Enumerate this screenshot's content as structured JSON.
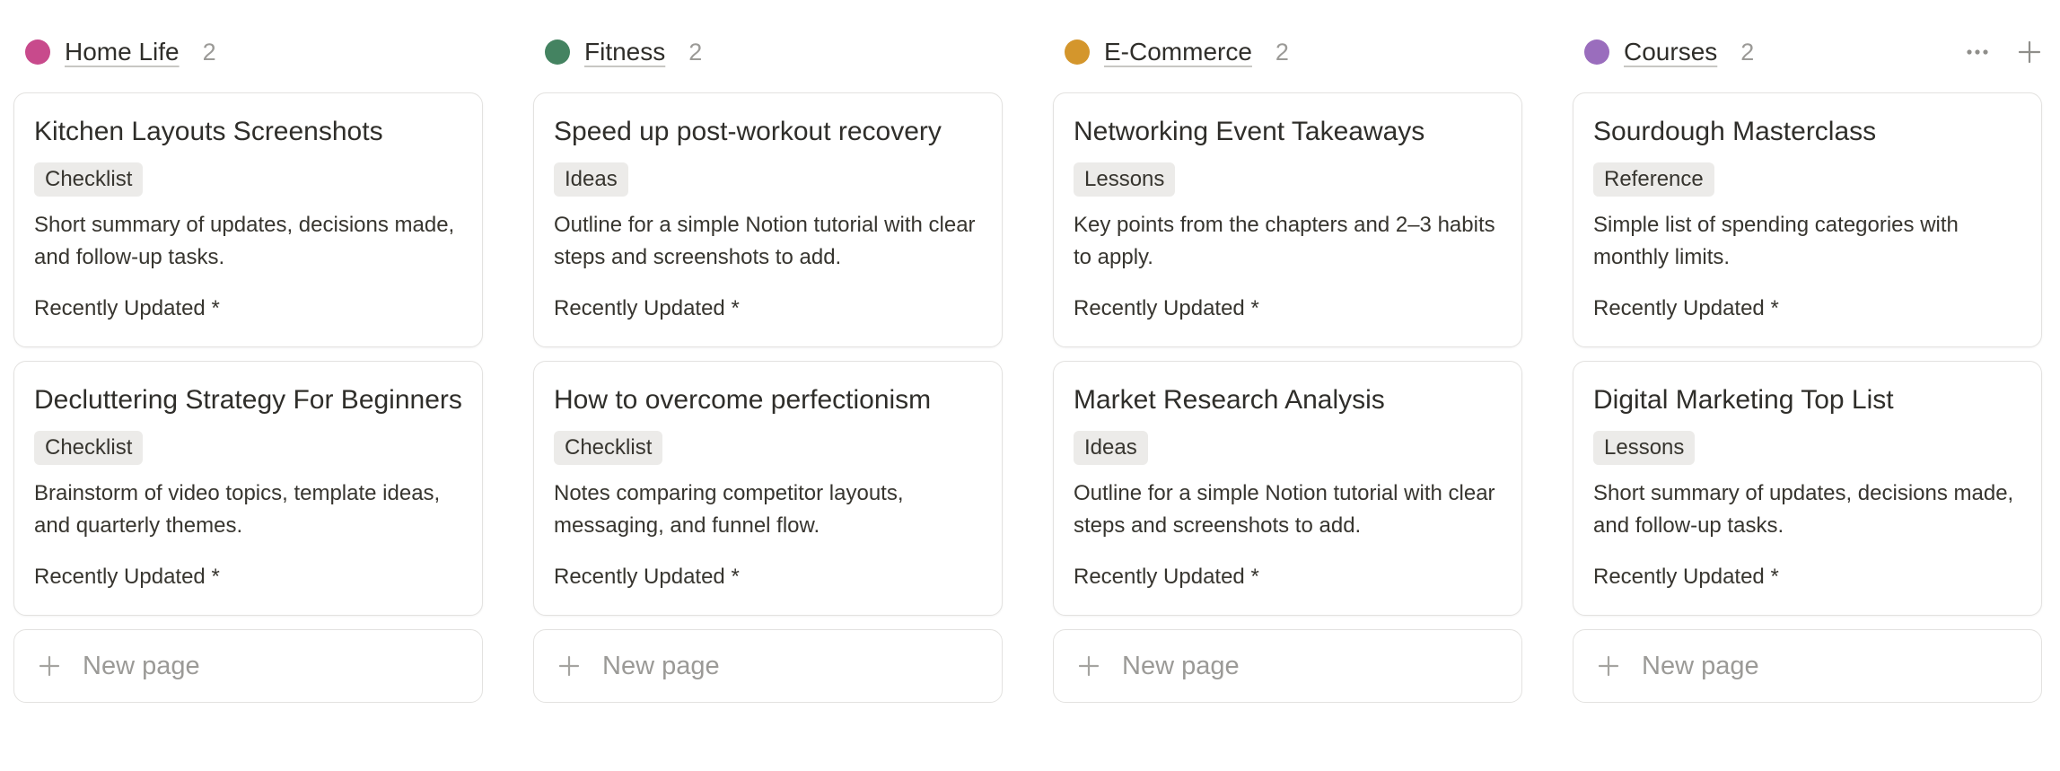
{
  "columns": [
    {
      "title": "Home Life",
      "count": "2",
      "color": "#c84a8c",
      "cards": [
        {
          "title": "Kitchen Layouts Screenshots",
          "tag": "Checklist",
          "description": "Short summary of updates, decisions made, and follow-up tasks.",
          "meta": "Recently Updated *"
        },
        {
          "title": "Decluttering Strategy For Beginners",
          "tag": "Checklist",
          "description": "Brainstorm of video topics, template ideas, and quarterly themes.",
          "meta": "Recently Updated *"
        }
      ],
      "new_page_label": "New page"
    },
    {
      "title": "Fitness",
      "count": "2",
      "color": "#448361",
      "cards": [
        {
          "title": "Speed up post-workout recovery",
          "tag": "Ideas",
          "description": "Outline for a simple Notion tutorial with clear steps and screenshots to add.",
          "meta": "Recently Updated *"
        },
        {
          "title": "How to overcome perfectionism",
          "tag": "Checklist",
          "description": "Notes comparing competitor layouts, messaging, and funnel flow.",
          "meta": "Recently Updated *"
        }
      ],
      "new_page_label": "New page"
    },
    {
      "title": "E-Commerce",
      "count": "2",
      "color": "#d4962c",
      "cards": [
        {
          "title": "Networking Event Takeaways",
          "tag": "Lessons",
          "description": "Key points from the chapters and 2–3 habits to apply.",
          "meta": "Recently Updated *"
        },
        {
          "title": "Market Research Analysis",
          "tag": "Ideas",
          "description": "Outline for a simple Notion tutorial with clear steps and screenshots to add.",
          "meta": "Recently Updated *"
        }
      ],
      "new_page_label": "New page"
    },
    {
      "title": "Courses",
      "count": "2",
      "color": "#9a6dbd",
      "cards": [
        {
          "title": "Sourdough Masterclass",
          "tag": "Reference",
          "description": "Simple list of spending categories with monthly limits.",
          "meta": "Recently Updated *"
        },
        {
          "title": "Digital Marketing Top List",
          "tag": "Lessons",
          "description": "Short summary of updates, decisions made, and follow-up tasks.",
          "meta": "Recently Updated *"
        }
      ],
      "new_page_label": "New page"
    }
  ],
  "header_actions": {
    "more_icon": "more-horizontal-icon",
    "add_icon": "plus-icon"
  }
}
